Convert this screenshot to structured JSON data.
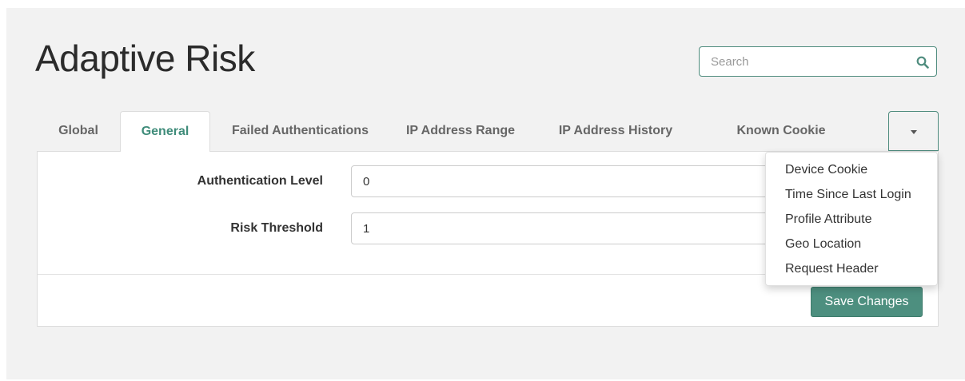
{
  "page": {
    "title": "Adaptive Risk"
  },
  "search": {
    "placeholder": "Search",
    "icon": "search-icon"
  },
  "tabs": [
    {
      "label": "Global",
      "active": false
    },
    {
      "label": "General",
      "active": true
    },
    {
      "label": "Failed Authentications",
      "active": false
    },
    {
      "label": "IP Address Range",
      "active": false
    },
    {
      "label": "IP Address History",
      "active": false
    },
    {
      "label": "Known Cookie",
      "active": false
    }
  ],
  "dropdown": {
    "items": [
      "Device Cookie",
      "Time Since Last Login",
      "Profile Attribute",
      "Geo Location",
      "Request Header"
    ]
  },
  "form": {
    "authentication_level": {
      "label": "Authentication Level",
      "value": "0"
    },
    "risk_threshold": {
      "label": "Risk Threshold",
      "value": "1"
    }
  },
  "actions": {
    "save_label": "Save Changes"
  },
  "colors": {
    "accent": "#4d8f7f",
    "active_tab_text": "#3f8c7a",
    "background": "#f2f2f2"
  }
}
